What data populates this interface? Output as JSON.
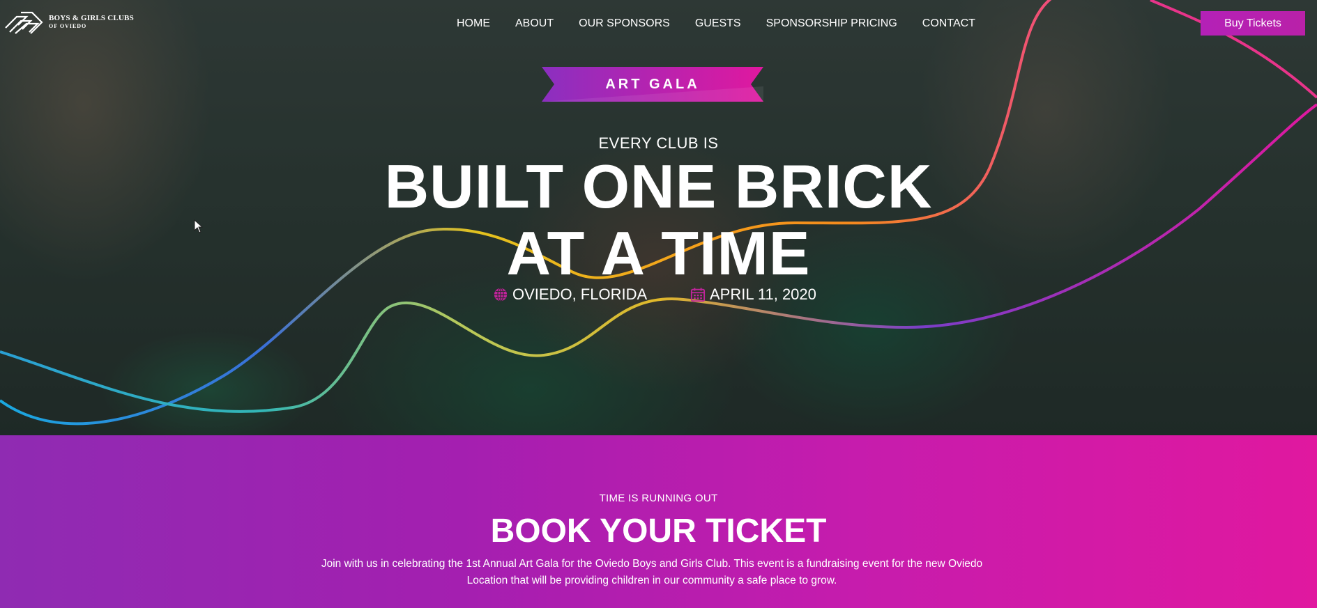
{
  "brand": {
    "name_line1": "BOYS & GIRLS CLUBS",
    "name_line2": "OF OVIEDO"
  },
  "nav": {
    "items": [
      "HOME",
      "ABOUT",
      "OUR SPONSORS",
      "GUESTS",
      "SPONSORSHIP PRICING",
      "CONTACT"
    ],
    "cta_label": "Buy Tickets"
  },
  "hero": {
    "ribbon_label": "ART GALA",
    "kicker": "EVERY CLUB IS",
    "headline_line1": "BUILT ONE BRICK",
    "headline_line2": "AT A TIME",
    "location": "OVIEDO, FLORIDA",
    "date": "APRIL 11, 2020"
  },
  "promo": {
    "kicker": "TIME IS RUNNING OUT",
    "title": "BOOK YOUR TICKET",
    "body": "Join with us in celebrating the 1st Annual Art Gala for the Oviedo Boys and Girls Club. This event is a fundraising event for the new Oviedo Location that will be providing children in our community a safe place to grow."
  },
  "colors": {
    "accent": "#b921a8",
    "gradient_start": "#8f2bb2",
    "gradient_end": "#e0189f"
  },
  "icons": {
    "location": "globe-icon",
    "date": "calendar-icon",
    "logo": "hands-logo-icon"
  }
}
